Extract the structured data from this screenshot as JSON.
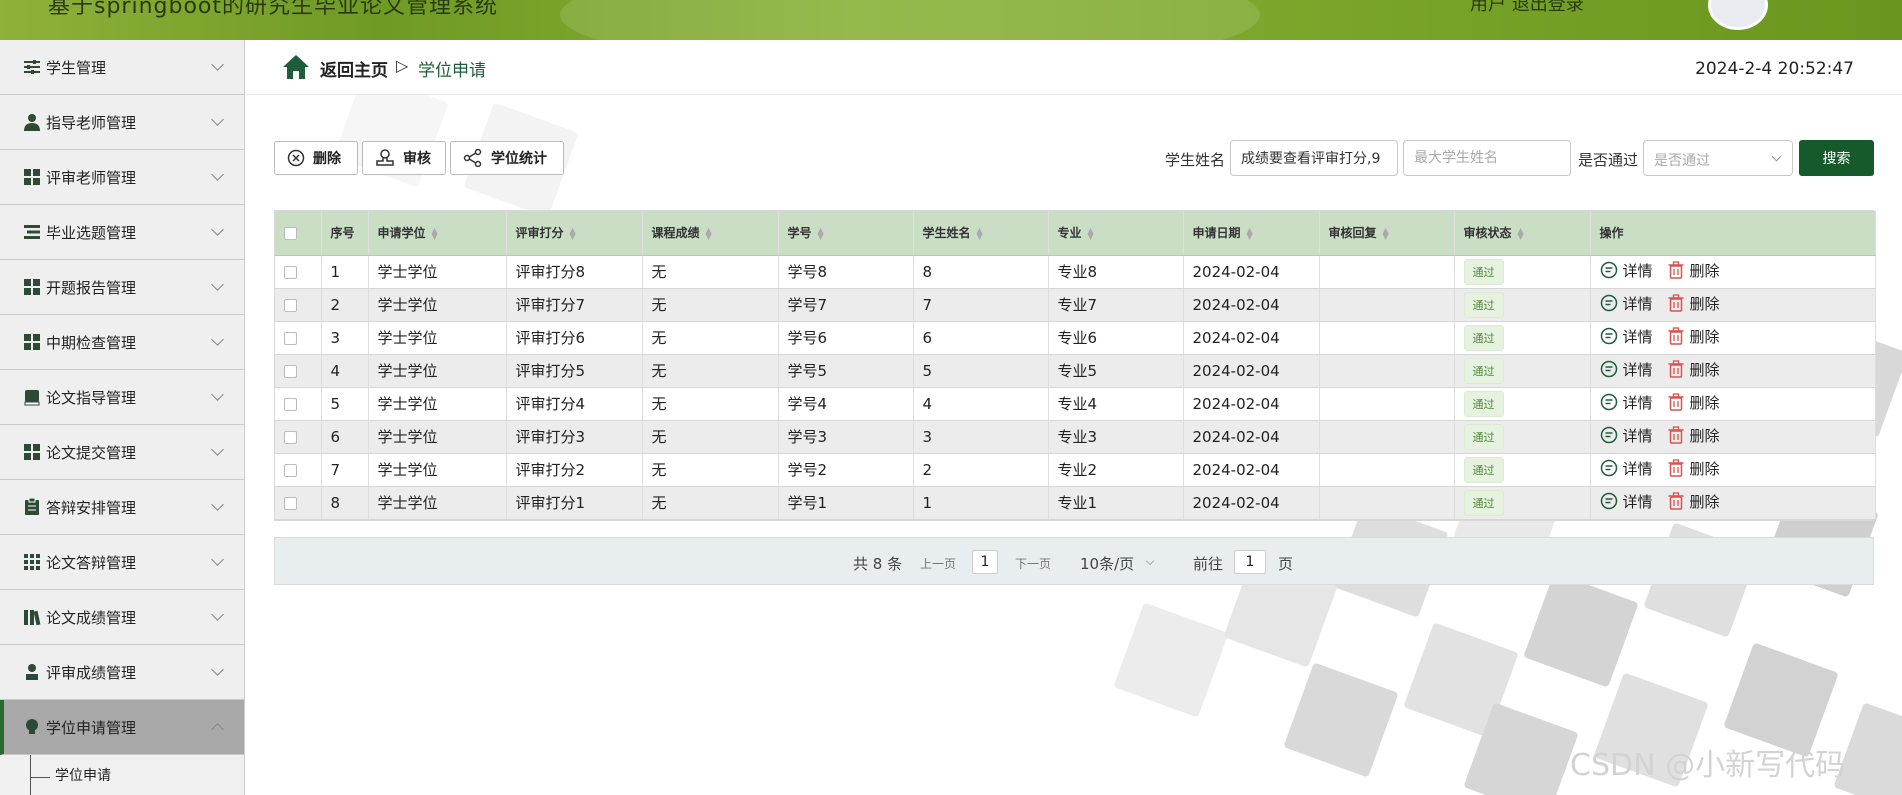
{
  "header": {
    "system_title": "基于springboot的研究生毕业论文管理系统",
    "top_right": "用户    退出登录"
  },
  "sidebar": {
    "items": [
      {
        "label": "学生管理",
        "icon": "sliders-icon"
      },
      {
        "label": "指导老师管理",
        "icon": "user-icon"
      },
      {
        "label": "评审老师管理",
        "icon": "grid-icon"
      },
      {
        "label": "毕业选题管理",
        "icon": "list-icon"
      },
      {
        "label": "开题报告管理",
        "icon": "grid-icon"
      },
      {
        "label": "中期检查管理",
        "icon": "grid-icon"
      },
      {
        "label": "论文指导管理",
        "icon": "book-icon"
      },
      {
        "label": "论文提交管理",
        "icon": "grid-icon"
      },
      {
        "label": "答辩安排管理",
        "icon": "clipboard-icon"
      },
      {
        "label": "论文答辩管理",
        "icon": "apps-icon"
      },
      {
        "label": "论文成绩管理",
        "icon": "library-icon"
      },
      {
        "label": "评审成绩管理",
        "icon": "user-icon"
      },
      {
        "label": "学位申请管理",
        "icon": "bulb-icon"
      }
    ],
    "active_sub": "学位申请"
  },
  "breadcrumb": {
    "home": "返回主页",
    "separator": "▷",
    "current": "学位申请"
  },
  "clock": "2024-2-4 20:52:47",
  "toolbar": {
    "delete_label": "删除",
    "review_label": "审核",
    "stats_label": "学位统计"
  },
  "search": {
    "name_label": "学生姓名",
    "name_value": "成绩要查看评审打分,9",
    "max_name_placeholder": "最大学生姓名",
    "pass_label": "是否通过",
    "pass_placeholder": "是否通过",
    "search_label": "搜索"
  },
  "table": {
    "headers": [
      "序号",
      "申请学位",
      "评审打分",
      "课程成绩",
      "学号",
      "学生姓名",
      "专业",
      "申请日期",
      "审核回复",
      "审核状态",
      "操作"
    ],
    "rows": [
      {
        "idx": "1",
        "degree": "学士学位",
        "score": "评审打分8",
        "course": "无",
        "sid": "学号8",
        "name": "8",
        "major": "专业8",
        "date": "2024-02-04",
        "reply": "",
        "status": "通过"
      },
      {
        "idx": "2",
        "degree": "学士学位",
        "score": "评审打分7",
        "course": "无",
        "sid": "学号7",
        "name": "7",
        "major": "专业7",
        "date": "2024-02-04",
        "reply": "",
        "status": "通过"
      },
      {
        "idx": "3",
        "degree": "学士学位",
        "score": "评审打分6",
        "course": "无",
        "sid": "学号6",
        "name": "6",
        "major": "专业6",
        "date": "2024-02-04",
        "reply": "",
        "status": "通过"
      },
      {
        "idx": "4",
        "degree": "学士学位",
        "score": "评审打分5",
        "course": "无",
        "sid": "学号5",
        "name": "5",
        "major": "专业5",
        "date": "2024-02-04",
        "reply": "",
        "status": "通过"
      },
      {
        "idx": "5",
        "degree": "学士学位",
        "score": "评审打分4",
        "course": "无",
        "sid": "学号4",
        "name": "4",
        "major": "专业4",
        "date": "2024-02-04",
        "reply": "",
        "status": "通过"
      },
      {
        "idx": "6",
        "degree": "学士学位",
        "score": "评审打分3",
        "course": "无",
        "sid": "学号3",
        "name": "3",
        "major": "专业3",
        "date": "2024-02-04",
        "reply": "",
        "status": "通过"
      },
      {
        "idx": "7",
        "degree": "学士学位",
        "score": "评审打分2",
        "course": "无",
        "sid": "学号2",
        "name": "2",
        "major": "专业2",
        "date": "2024-02-04",
        "reply": "",
        "status": "通过"
      },
      {
        "idx": "8",
        "degree": "学士学位",
        "score": "评审打分1",
        "course": "无",
        "sid": "学号1",
        "name": "1",
        "major": "专业1",
        "date": "2024-02-04",
        "reply": "",
        "status": "通过"
      }
    ],
    "detail_label": "详情",
    "delete_label": "删除"
  },
  "pagination": {
    "total": "共 8 条",
    "prev": "上一页",
    "page": "1",
    "next": "下一页",
    "page_size": "10条/页",
    "goto_label": "前往",
    "goto_value": "1",
    "page_suffix": "页"
  },
  "watermark": "CSDN @小新写代码",
  "colors": {
    "primary": "#155a2a",
    "header_green": "#7aa52a",
    "table_header": "#c9dec5",
    "badge_text": "#4f8a3c"
  }
}
